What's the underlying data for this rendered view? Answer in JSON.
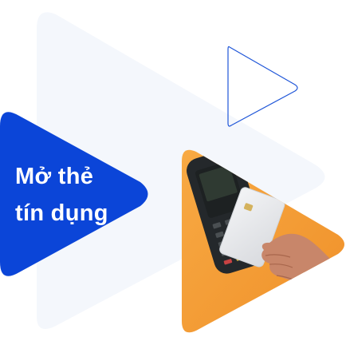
{
  "promo": {
    "title_line1": "Mở thẻ",
    "title_line2": "tín dụng"
  },
  "colors": {
    "background": "#ffffff",
    "background_triangle": "#f4f7fc",
    "outline_triangle": "#1f56d8",
    "badge": "#0b45d8",
    "photo_base": "#f5a03c",
    "card": "#e8e9ec",
    "terminal": "#24282b"
  },
  "icons": {
    "outline_triangle": "play-outline-icon",
    "badge": "triangle-badge-icon"
  },
  "image": {
    "subject": "hand-holding-card-over-payment-terminal-photo"
  }
}
